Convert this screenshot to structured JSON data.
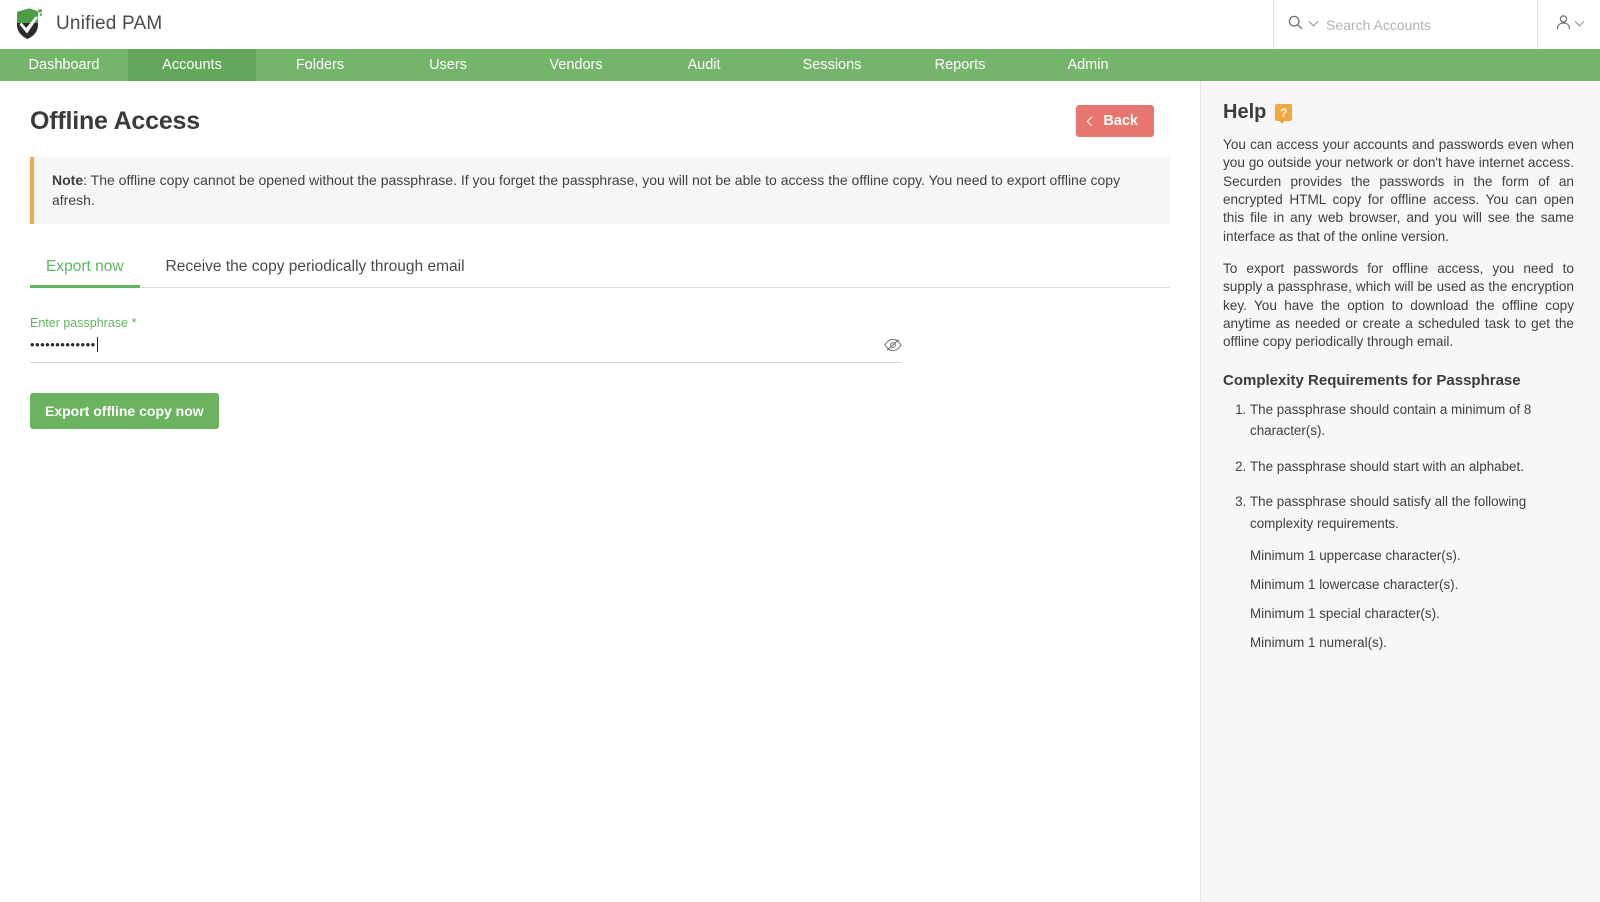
{
  "topbar": {
    "brand_name": "Unified PAM",
    "logo_icon": "shield-check-logo",
    "search": {
      "icon": "search-icon",
      "dropdown_icon": "chevron-down-icon",
      "placeholder": "Search Accounts",
      "value": ""
    },
    "user_menu": {
      "icon": "user-icon",
      "dropdown_icon": "chevron-down-icon"
    }
  },
  "nav": {
    "items": [
      {
        "label": "Dashboard",
        "active": false
      },
      {
        "label": "Accounts",
        "active": true
      },
      {
        "label": "Folders",
        "active": false
      },
      {
        "label": "Users",
        "active": false
      },
      {
        "label": "Vendors",
        "active": false
      },
      {
        "label": "Audit",
        "active": false
      },
      {
        "label": "Sessions",
        "active": false
      },
      {
        "label": "Reports",
        "active": false
      },
      {
        "label": "Admin",
        "active": false
      }
    ],
    "active_bg": "#63a85a",
    "bg": "#74b56b"
  },
  "main": {
    "page_title": "Offline Access",
    "back_button": {
      "label": "Back",
      "icon": "chevron-left-icon",
      "color": "#e8766f"
    },
    "note": {
      "prefix": "Note",
      "text": ": The offline copy cannot be opened without the passphrase. If you forget the passphrase, you will not be able to access the offline copy. You need to export offline copy afresh.",
      "accent_color": "#f0ad4e"
    },
    "tabs": [
      {
        "label": "Export now",
        "active": true
      },
      {
        "label": "Receive the copy periodically through email",
        "active": false
      }
    ],
    "passphrase_field": {
      "label": "Enter passphrase *",
      "label_color": "#5cb85c",
      "masked_value": "•••••••••••••",
      "toggle_icon": "eye-off-icon"
    },
    "export_button": {
      "label": "Export offline copy now",
      "color": "#6cb35f"
    }
  },
  "help": {
    "title": "Help",
    "badge_icon": "question-mark-icon",
    "badge_label": "?",
    "badge_color": "#f0a93c",
    "paragraphs": [
      "You can access your accounts and passwords even when you go outside your network or don't have internet access. Securden provides the passwords in the form of an encrypted HTML copy for offline access. You can open this file in any web browser, and you will see the same interface as that of the online version.",
      "To export passwords for offline access, you need to supply a passphrase, which will be used as the encryption key. You have the option to download the offline copy anytime as needed or create a scheduled task to get the offline copy periodically through email."
    ],
    "requirements_title": "Complexity Requirements for Passphrase",
    "requirements": [
      "The passphrase should contain a minimum of 8 character(s).",
      "The passphrase should start with an alphabet.",
      "The passphrase should satisfy all the following complexity requirements."
    ],
    "sub_requirements": [
      "Minimum 1 uppercase character(s).",
      "Minimum 1 lowercase character(s).",
      "Minimum 1 special character(s).",
      "Minimum 1 numeral(s)."
    ]
  }
}
